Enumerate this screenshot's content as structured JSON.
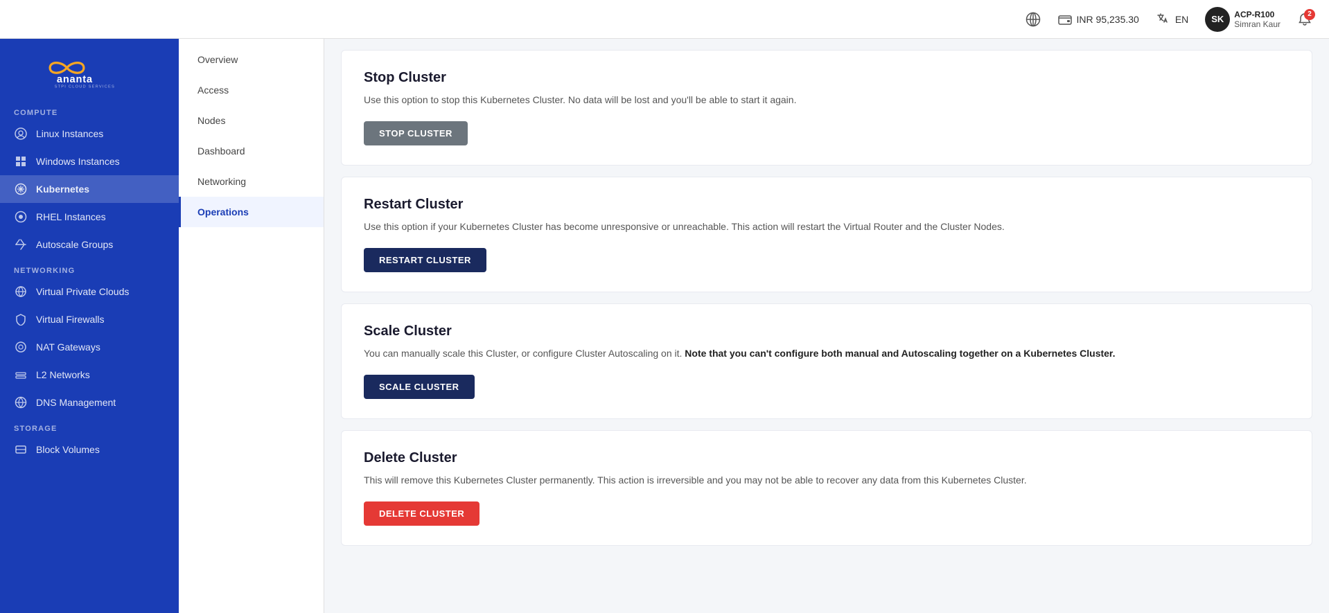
{
  "topbar": {
    "globe_icon": "🌐",
    "balance": "INR 95,235.30",
    "lang": "EN",
    "avatar_initials": "SK",
    "account_id": "ACP-R100",
    "user_name": "Simran Kaur",
    "notif_count": "2"
  },
  "sidebar": {
    "logo_text": "ananta",
    "logo_sub": "STPI CLOUD SERVICES",
    "sections": [
      {
        "label": "COMPUTE",
        "items": [
          {
            "id": "linux-instances",
            "label": "Linux Instances",
            "icon": "🖥"
          },
          {
            "id": "windows-instances",
            "label": "Windows Instances",
            "icon": "⊞"
          },
          {
            "id": "kubernetes",
            "label": "Kubernetes",
            "icon": "⚙",
            "active": true
          },
          {
            "id": "rhel-instances",
            "label": "RHEL Instances",
            "icon": "🔴"
          },
          {
            "id": "autoscale-groups",
            "label": "Autoscale Groups",
            "icon": "↔"
          }
        ]
      },
      {
        "label": "NETWORKING",
        "items": [
          {
            "id": "vpcs",
            "label": "Virtual Private Clouds",
            "icon": "☁"
          },
          {
            "id": "firewalls",
            "label": "Virtual Firewalls",
            "icon": "🛡"
          },
          {
            "id": "nat-gateways",
            "label": "NAT Gateways",
            "icon": "◎"
          },
          {
            "id": "l2-networks",
            "label": "L2 Networks",
            "icon": "⊟"
          },
          {
            "id": "dns-management",
            "label": "DNS Management",
            "icon": "🌐"
          }
        ]
      },
      {
        "label": "STORAGE",
        "items": [
          {
            "id": "block-volumes",
            "label": "Block Volumes",
            "icon": "▪"
          }
        ]
      }
    ]
  },
  "subnav": {
    "items": [
      {
        "id": "overview",
        "label": "Overview"
      },
      {
        "id": "access",
        "label": "Access"
      },
      {
        "id": "nodes",
        "label": "Nodes"
      },
      {
        "id": "dashboard",
        "label": "Dashboard"
      },
      {
        "id": "networking",
        "label": "Networking"
      },
      {
        "id": "operations",
        "label": "Operations",
        "active": true
      }
    ]
  },
  "operations": {
    "stop_cluster": {
      "title": "Stop Cluster",
      "description": "Use this option to stop this Kubernetes Cluster. No data will be lost and you'll be able to start it again.",
      "button_label": "STOP CLUSTER"
    },
    "restart_cluster": {
      "title": "Restart Cluster",
      "description": "Use this option if your Kubernetes Cluster has become unresponsive or unreachable. This action will restart the Virtual Router and the Cluster Nodes.",
      "button_label": "RESTART CLUSTER"
    },
    "scale_cluster": {
      "title": "Scale Cluster",
      "description_normal": "You can manually scale this Cluster, or configure Cluster Autoscaling on it. ",
      "description_bold": "Note that you can't configure both manual and Autoscaling together on a Kubernetes Cluster.",
      "button_label": "SCALE CLUSTER"
    },
    "delete_cluster": {
      "title": "Delete Cluster",
      "description": "This will remove this Kubernetes Cluster permanently. This action is irreversible and you may not be able to recover any data from this Kubernetes Cluster.",
      "button_label": "DELETE CLUSTER"
    }
  }
}
